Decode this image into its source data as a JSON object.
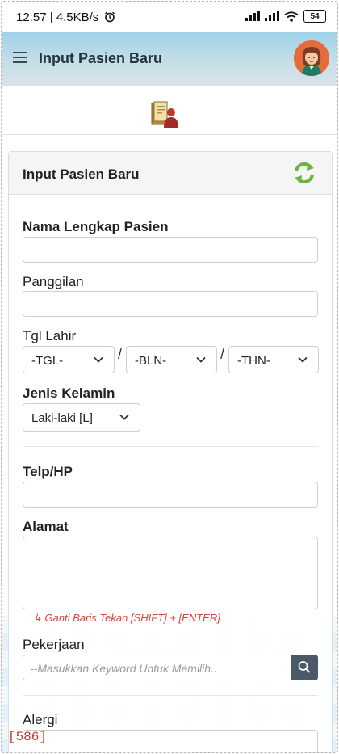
{
  "status_bar": {
    "time_speed": "12:57 | 4.5KB/s",
    "battery": "54"
  },
  "app_bar": {
    "title": "Input Pasien Baru"
  },
  "card": {
    "title": "Input Pasien Baru"
  },
  "form": {
    "nama_label": "Nama Lengkap Pasien",
    "panggilan_label": "Panggilan",
    "tgl_lahir_label": "Tgl Lahir",
    "tgl_select": "-TGL-",
    "bln_select": "-BLN-",
    "thn_select": "-THN-",
    "date_separator": "/",
    "jenis_kelamin_label": "Jenis Kelamin",
    "jenis_kelamin_value": "Laki-laki [L]",
    "telp_label": "Telp/HP",
    "alamat_label": "Alamat",
    "alamat_hint": "↳ Ganti Baris Tekan [SHIFT] + [ENTER]",
    "pekerjaan_label": "Pekerjaan",
    "pekerjaan_placeholder": "--Masukkan Keyword Untuk Memilih..",
    "alergi_label": "Alergi"
  },
  "debug_tag": "[586]",
  "colors": {
    "app_bar_top": "#9fd2e8",
    "search_button": "#4a5868",
    "hint_red": "#d6463a",
    "refresh_green": "#6cb33f"
  },
  "icons": [
    "menu-icon",
    "alarm-icon",
    "signal-icon",
    "wifi-icon",
    "battery-icon",
    "avatar",
    "patient-logo-icon",
    "refresh-icon",
    "chevron-down-icon",
    "search-icon"
  ]
}
